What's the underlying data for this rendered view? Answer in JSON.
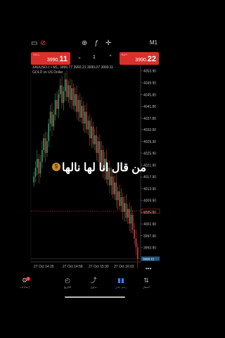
{
  "toolbar": {
    "timeframe": "M1"
  },
  "trade": {
    "sell_label": "SELL",
    "sell_price_main": "3990.",
    "sell_price_big": "11",
    "buy_label": "BUY",
    "buy_price_main": "3990.",
    "buy_price_big": "22",
    "lot": "1"
  },
  "chart_info": {
    "line1": "XAUUSD.c • M1, 3990.77 3992.21 3990.07 3990.11",
    "line2": "GOLD vs US Dollar"
  },
  "overlay": {
    "text": "من قال انا لها نالها",
    "emoji": "$"
  },
  "chart_data": {
    "type": "candlestick",
    "symbol": "XAUUSD.c",
    "timeframe": "M1",
    "price_ticks": [
      "4053.90",
      "4049.90",
      "4045.80",
      "4041.80",
      "4037.80",
      "4033.90",
      "4029.90",
      "4025.90",
      "4021.90",
      "4017.90",
      "4013.90",
      "4009.90",
      "4005.90",
      "4001.90",
      "3997.90",
      "3993.90"
    ],
    "time_ticks": [
      "27 Oct 14:26",
      "27 Oct 14:58",
      "27 Oct 15:30",
      "27 Oct 16:02"
    ],
    "bid_line": "3990.11",
    "order_line": "4006.23",
    "closes": [
      4018,
      4021,
      4024,
      4019,
      4023,
      4027,
      4031,
      4026,
      4030,
      4036,
      4040,
      4035,
      4039,
      4044,
      4041,
      4046,
      4049,
      4043,
      4047,
      4051,
      4045,
      4049,
      4044,
      4048,
      4042,
      4046,
      4040,
      4044,
      4038,
      4042,
      4036,
      4040,
      4034,
      4037,
      4031,
      4035,
      4029,
      4032,
      4026,
      4030,
      4023,
      4027,
      4020,
      4024,
      4017,
      4021,
      4015,
      4018,
      4012,
      4016,
      4010,
      4013,
      4008,
      4011,
      4006,
      4009,
      4004,
      4007,
      4002,
      4005,
      4000,
      3997,
      3994,
      3990
    ]
  },
  "nav": [
    {
      "label": "إعدادات",
      "icon": "gear-icon"
    },
    {
      "label": "التاريخ",
      "icon": "history-icon"
    },
    {
      "label": "تداول",
      "icon": "trade-icon"
    },
    {
      "label": "رسم بياني",
      "icon": "chart-icon"
    },
    {
      "label": "أسعار",
      "icon": "quotes-icon"
    }
  ],
  "nav_badge": "3"
}
